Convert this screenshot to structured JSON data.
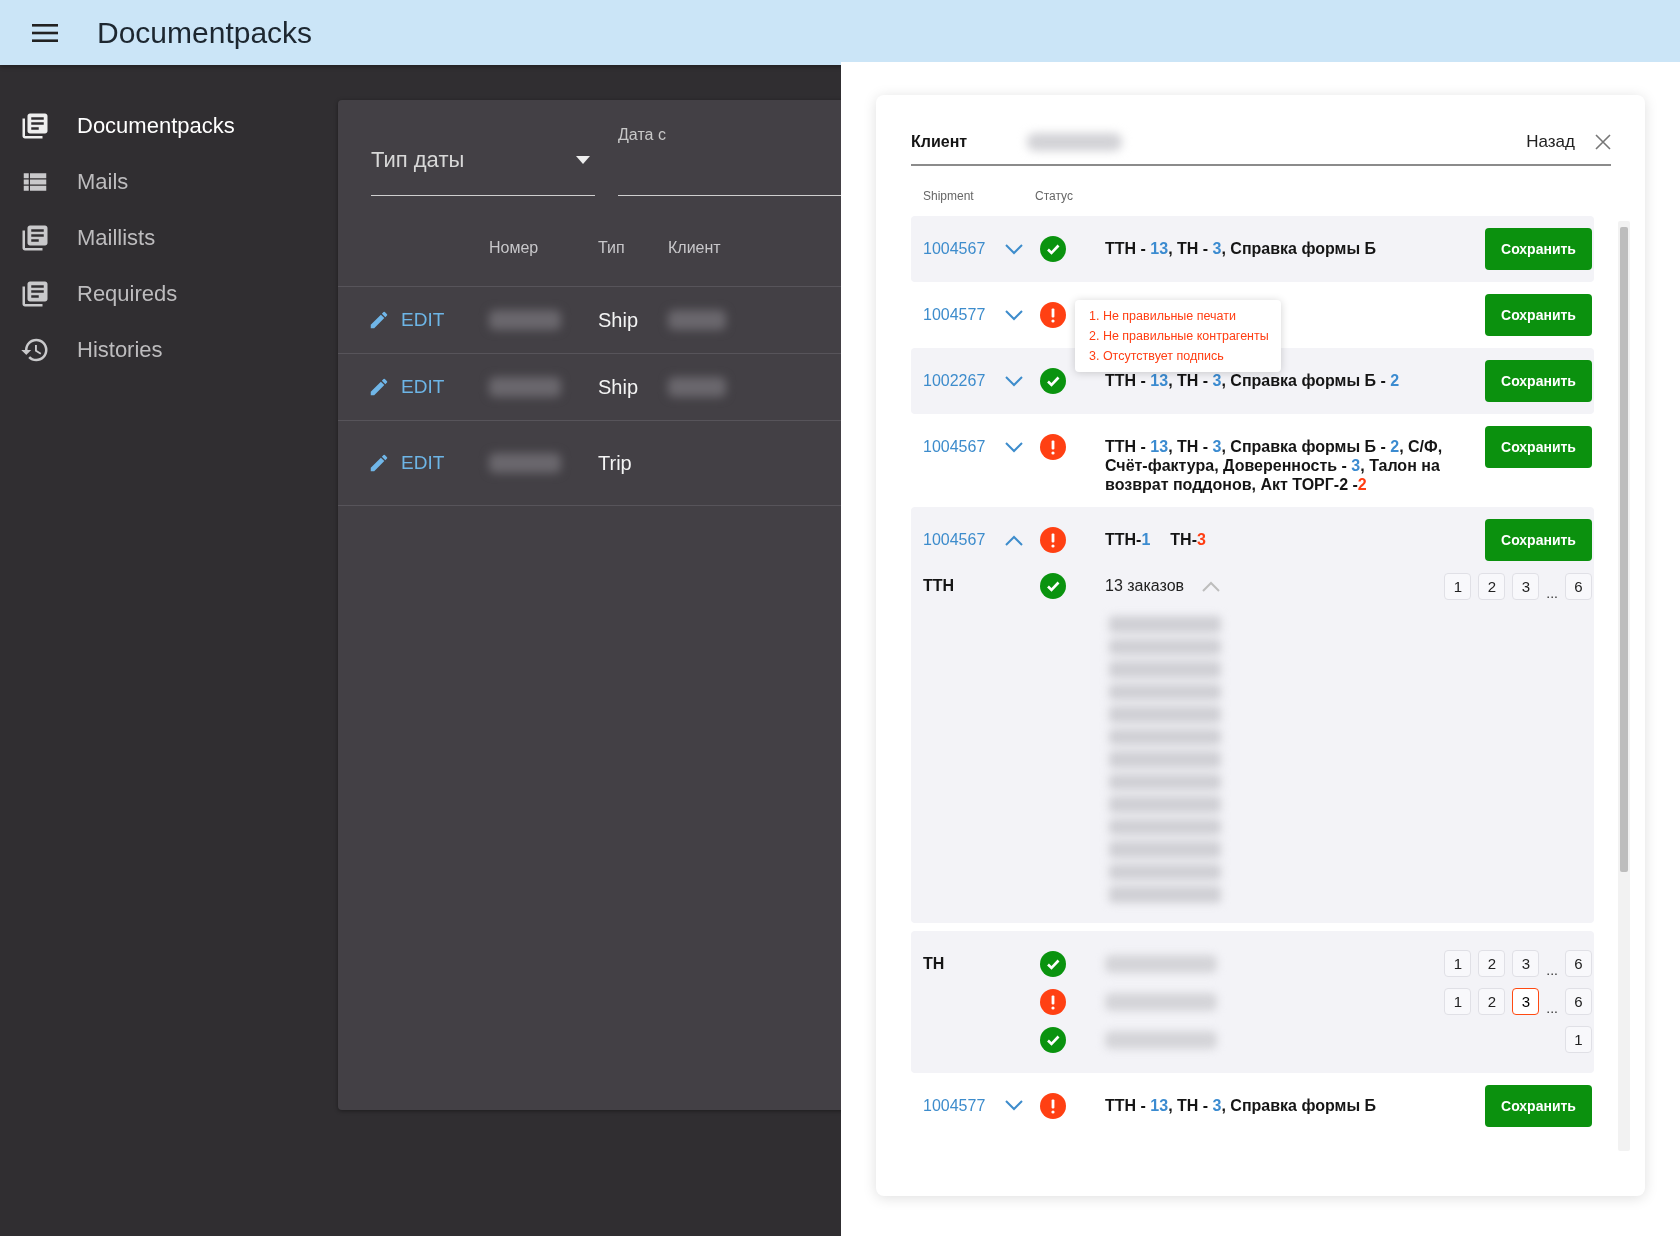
{
  "app_bar": {
    "title": "Documentpacks"
  },
  "sidebar": {
    "items": [
      {
        "label": "Documentpacks",
        "selected": true
      },
      {
        "label": "Mails",
        "selected": false
      },
      {
        "label": "Maillists",
        "selected": false
      },
      {
        "label": "Requireds",
        "selected": false
      },
      {
        "label": "Histories",
        "selected": false
      }
    ]
  },
  "filters": {
    "date_type": {
      "placeholder": "Тип даты"
    },
    "date_from": {
      "label": "Дата с"
    }
  },
  "table": {
    "columns": [
      "Номер",
      "Тип",
      "Клиент"
    ],
    "rows": [
      {
        "action": "EDIT",
        "type": "Ship"
      },
      {
        "action": "EDIT",
        "type": "Ship"
      },
      {
        "action": "EDIT",
        "type": "Trip"
      }
    ]
  },
  "detail": {
    "client_label": "Клиент",
    "back": "Назад",
    "columns": [
      "Shipment",
      "Статус"
    ],
    "shipments": [
      {
        "number": "1004567",
        "expanded": false,
        "kind": "ok",
        "docs": [
          {
            "text": "ТТН - ",
            "kind": "text"
          },
          {
            "text": "13",
            "kind": "count"
          },
          {
            "text": ", ТН - ",
            "kind": "text"
          },
          {
            "text": "3",
            "kind": "count"
          },
          {
            "text": ", Справка формы Б",
            "kind": "text"
          }
        ],
        "save": "Сохранить"
      },
      {
        "number": "1004577",
        "expanded": false,
        "kind": "error",
        "errors": [
          "1. Не правильные печати",
          "2. Не правильные контрагенты",
          "3. Отсутствует подпись"
        ],
        "save": "Сохранить"
      },
      {
        "number": "1002267",
        "expanded": false,
        "kind": "ok",
        "docs": [
          {
            "text": "ТТН - ",
            "kind": "text"
          },
          {
            "text": "13",
            "kind": "count"
          },
          {
            "text": ", ТН - ",
            "kind": "text"
          },
          {
            "text": "3",
            "kind": "count"
          },
          {
            "text": ", Справка формы Б - ",
            "kind": "text"
          },
          {
            "text": "2",
            "kind": "count"
          }
        ],
        "save": "Сохранить"
      },
      {
        "number": "1004567",
        "expanded": false,
        "kind": "error",
        "docs": [
          {
            "text": "ТТН - ",
            "kind": "text"
          },
          {
            "text": "13",
            "kind": "count"
          },
          {
            "text": ", ТН - ",
            "kind": "text"
          },
          {
            "text": "3",
            "kind": "count"
          },
          {
            "text": ", Справка формы Б - ",
            "kind": "text"
          },
          {
            "text": "2",
            "kind": "count"
          },
          {
            "text": ", С/Ф, Счёт-фактура, Доверенность - ",
            "kind": "text"
          },
          {
            "text": "3",
            "kind": "count"
          },
          {
            "text": ", Талон на возврат поддонов, Акт ТОРГ-2 -",
            "kind": "text"
          },
          {
            "text": "2",
            "kind": "missing"
          }
        ],
        "save": "Сохранить"
      },
      {
        "number": "1004567",
        "expanded": true,
        "kind": "error",
        "summary": [
          {
            "name": "ТТН-",
            "count": "1",
            "kind": "count"
          },
          {
            "name": "ТН-",
            "count": "3",
            "kind": "missing"
          }
        ],
        "save": "Сохранить",
        "groups": [
          {
            "name": "ТТН",
            "lines": [
              {
                "kind": "ok",
                "orders": "13 заказов",
                "orders_expanded": true,
                "pages": [
                  {
                    "label": "1",
                    "kind": "page",
                    "selected": false
                  },
                  {
                    "label": "2",
                    "kind": "page",
                    "selected": false
                  },
                  {
                    "label": "3",
                    "kind": "page",
                    "selected": false
                  },
                  {
                    "label": "...",
                    "kind": "gap"
                  },
                  {
                    "label": "6",
                    "kind": "page",
                    "selected": false
                  }
                ]
              }
            ]
          },
          {
            "name": "ТН",
            "lines": [
              {
                "kind": "ok",
                "pages": [
                  {
                    "label": "1",
                    "kind": "page",
                    "selected": false
                  },
                  {
                    "label": "2",
                    "kind": "page",
                    "selected": false
                  },
                  {
                    "label": "3",
                    "kind": "page",
                    "selected": false
                  },
                  {
                    "label": "...",
                    "kind": "gap"
                  },
                  {
                    "label": "6",
                    "kind": "page",
                    "selected": false
                  }
                ]
              },
              {
                "kind": "error",
                "pages": [
                  {
                    "label": "1",
                    "kind": "page",
                    "selected": false
                  },
                  {
                    "label": "2",
                    "kind": "page",
                    "selected": false
                  },
                  {
                    "label": "3",
                    "kind": "page",
                    "selected": true
                  },
                  {
                    "label": "...",
                    "kind": "gap"
                  },
                  {
                    "label": "6",
                    "kind": "page",
                    "selected": false
                  }
                ]
              },
              {
                "kind": "ok",
                "pages": [
                  {
                    "label": "1",
                    "kind": "page",
                    "selected": false
                  }
                ]
              }
            ]
          }
        ]
      },
      {
        "number": "1004577",
        "expanded": false,
        "kind": "error",
        "docs": [
          {
            "text": "ТТН - ",
            "kind": "text"
          },
          {
            "text": "13",
            "kind": "count"
          },
          {
            "text": ", ТН - ",
            "kind": "text"
          },
          {
            "text": "3",
            "kind": "count"
          },
          {
            "text": ", Справка формы Б",
            "kind": "text"
          }
        ],
        "save": "Сохранить"
      }
    ]
  }
}
